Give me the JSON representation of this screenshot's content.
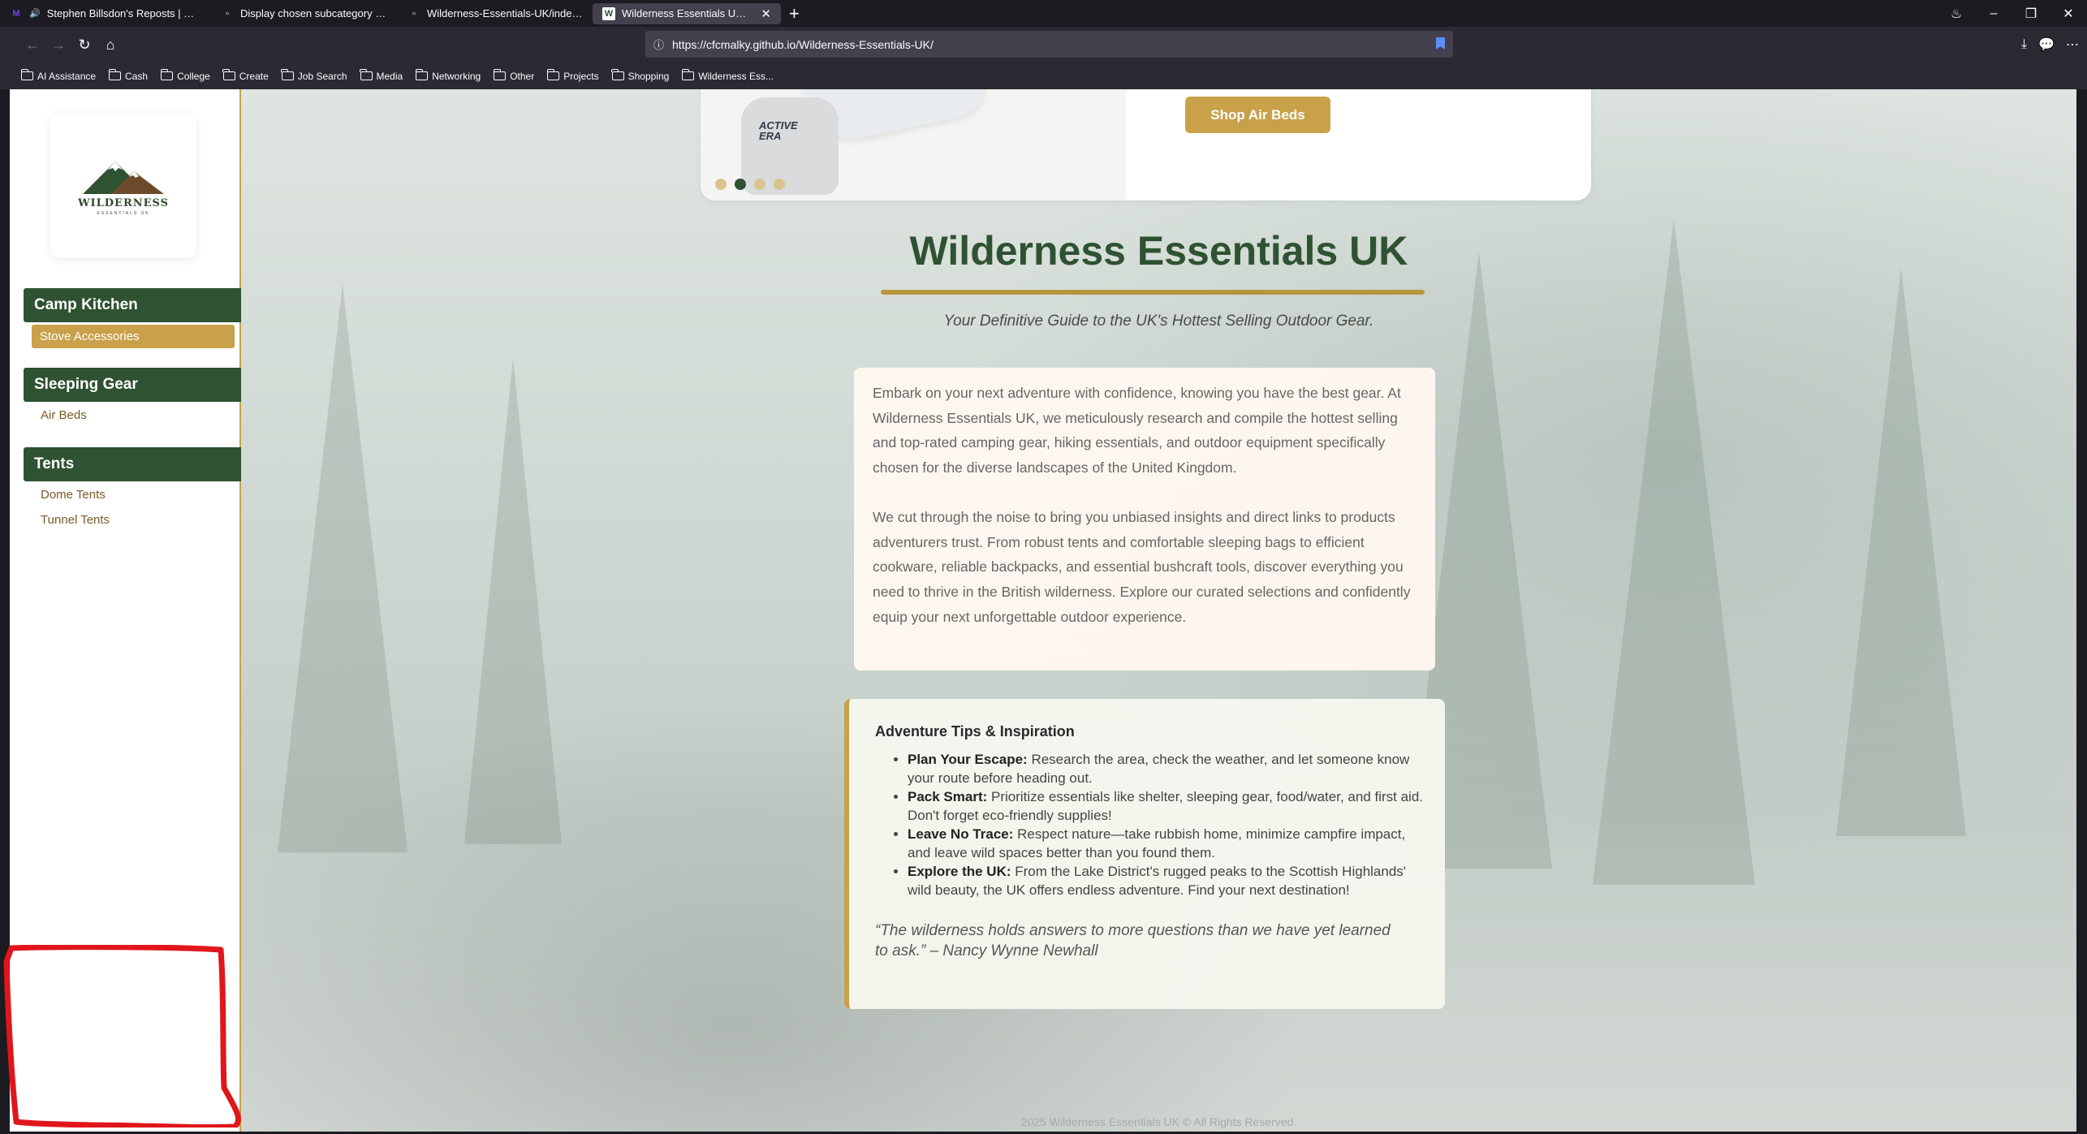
{
  "browser": {
    "tabs": [
      {
        "label": "Stephen Billsdon's Reposts | Mozi",
        "favicon": "M",
        "audio": true
      },
      {
        "label": "Display chosen subcategory in header",
        "favicon": ""
      },
      {
        "label": "Wilderness-Essentials-UK/index.html a",
        "favicon": ""
      },
      {
        "label": "Wilderness Essentials UK: Your",
        "favicon": "W",
        "active": true
      }
    ],
    "url": "https://cfcmalky.github.io/Wilderness-Essentials-UK/",
    "bookmarks": [
      "AI Assistance",
      "Cash",
      "College",
      "Create",
      "Job Search",
      "Media",
      "Networking",
      "Other",
      "Projects",
      "Shopping",
      "Wilderness Ess..."
    ]
  },
  "sidebar": {
    "logo": {
      "word": "WILDERNESS",
      "sub": "ESSENTIALS UK"
    },
    "categories": [
      {
        "name": "Camp Kitchen",
        "items": [
          "Stove Accessories"
        ]
      },
      {
        "name": "Sleeping Gear",
        "items": [
          "Air Beds"
        ]
      },
      {
        "name": "Tents",
        "items": [
          "Dome Tents",
          "Tunnel Tents"
        ]
      }
    ]
  },
  "hero": {
    "brand": "ACTIVE ERA",
    "button": "Shop Air Beds",
    "slides": 4,
    "active_slide": 2
  },
  "main": {
    "title": "Wilderness Essentials UK",
    "tagline": "Your Definitive Guide to the UK's Hottest Selling Outdoor Gear.",
    "intro_p1": "Embark on your next adventure with confidence, knowing you have the best gear. At Wilderness Essentials UK, we meticulously research and compile the hottest selling and top-rated camping gear, hiking essentials, and outdoor equipment specifically chosen for the diverse landscapes of the United Kingdom.",
    "intro_p2": "We cut through the noise to bring you unbiased insights and direct links to products adventurers trust. From robust tents and comfortable sleeping bags to efficient cookware, reliable backpacks, and essential bushcraft tools, discover everything you need to thrive in the British wilderness. Explore our curated selections and confidently equip your next unforgettable outdoor experience."
  },
  "tips": {
    "heading": "Adventure Tips & Inspiration",
    "items": [
      {
        "bold": "Plan Your Escape:",
        "text": " Research the area, check the weather, and let someone know your route before heading out."
      },
      {
        "bold": "Pack Smart:",
        "text": " Prioritize essentials like shelter, sleeping gear, food/water, and first aid. Don't forget eco-friendly supplies!"
      },
      {
        "bold": "Leave No Trace:",
        "text": " Respect nature—take rubbish home, minimize campfire impact, and leave wild spaces better than you found them."
      },
      {
        "bold": "Explore the UK:",
        "text": " From the Lake District's rugged peaks to the Scottish Highlands' wild beauty, the UK offers endless adventure. Find your next destination!"
      }
    ],
    "quote": "“The wilderness holds answers to more questions than we have yet learned to ask.” – Nancy Wynne Newhall"
  },
  "footer": "2025 Wilderness Essentials UK © All Rights Reserved.",
  "colors": {
    "primary": "#2f5232",
    "accent": "#c9a14a",
    "annotation": "#e0161b"
  }
}
